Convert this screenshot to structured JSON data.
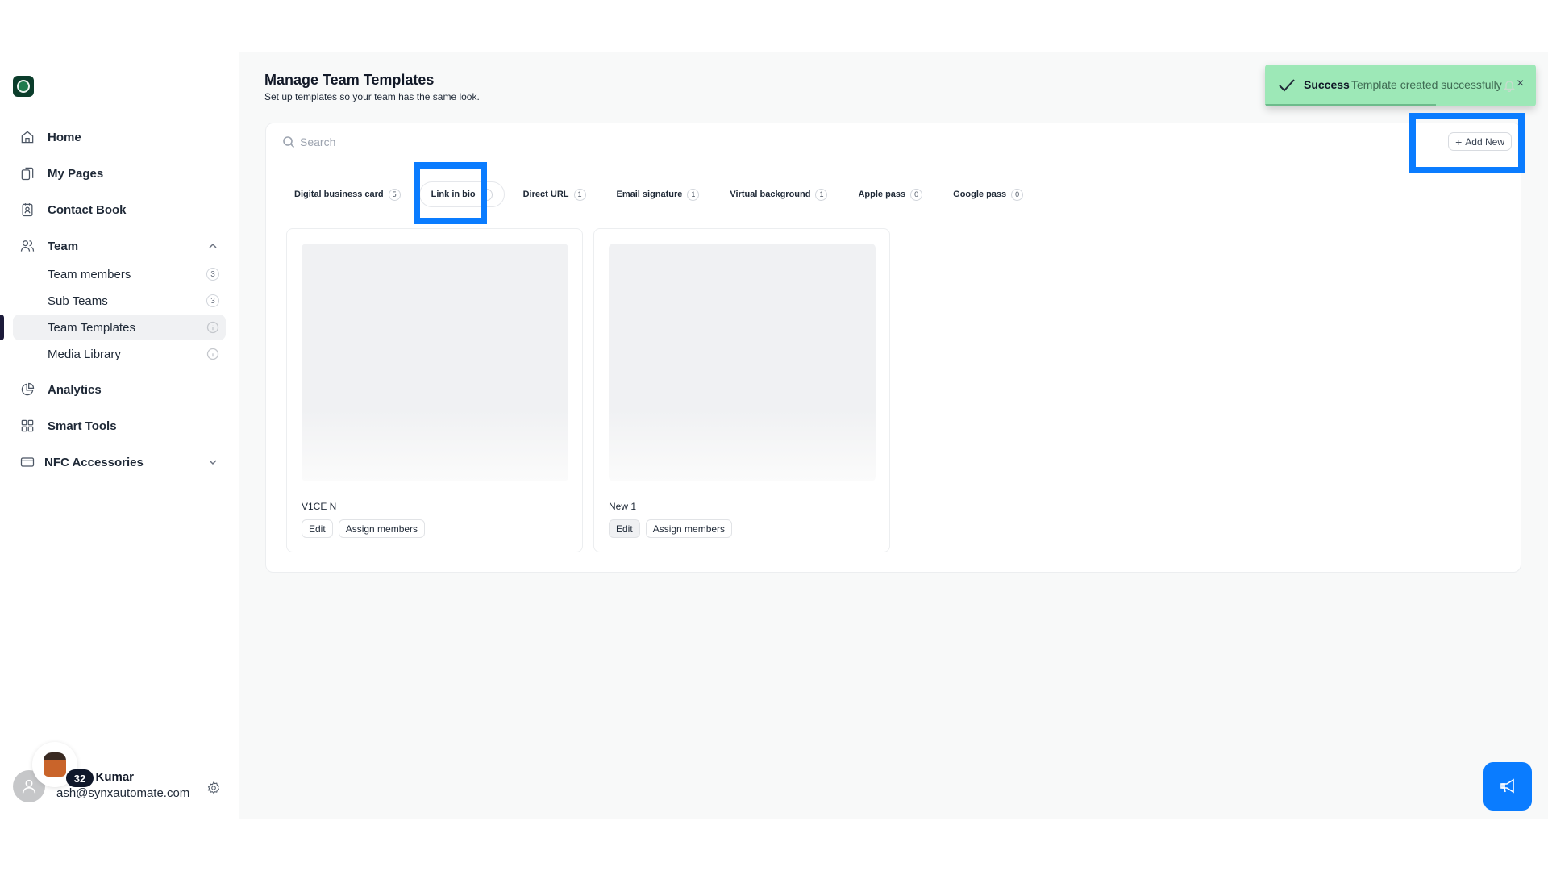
{
  "sidebar": {
    "nav": [
      {
        "label": "Home",
        "icon": "home-icon"
      },
      {
        "label": "My Pages",
        "icon": "pages-icon"
      },
      {
        "label": "Contact Book",
        "icon": "contact-book-icon"
      },
      {
        "label": "Team",
        "icon": "team-icon",
        "expanded": true
      },
      {
        "label": "Analytics",
        "icon": "analytics-icon"
      },
      {
        "label": "Smart Tools",
        "icon": "grid-icon"
      },
      {
        "label": "NFC Accessories",
        "icon": "card-icon",
        "expanded": false
      }
    ],
    "team_sub": [
      {
        "label": "Team members",
        "count": "3"
      },
      {
        "label": "Sub Teams",
        "count": "3"
      },
      {
        "label": "Team Templates",
        "active": true
      },
      {
        "label": "Media Library"
      }
    ],
    "user": {
      "badge": "32",
      "name": "y Kumar",
      "email": "ash@synxautomate.com"
    }
  },
  "main": {
    "title": "Manage Team Templates",
    "subtitle": "Set up templates so your team has the same look.",
    "search": {
      "placeholder": "Search",
      "value": ""
    },
    "add_new_label": "Add New",
    "tabs": [
      {
        "label": "Digital business card",
        "count": "5"
      },
      {
        "label": "Link in bio",
        "count": "",
        "active": true
      },
      {
        "label": "Direct URL",
        "count": "1"
      },
      {
        "label": "Email signature",
        "count": "1"
      },
      {
        "label": "Virtual background",
        "count": "1"
      },
      {
        "label": "Apple pass",
        "count": "0"
      },
      {
        "label": "Google pass",
        "count": "0"
      }
    ],
    "templates": [
      {
        "name": "V1CE N",
        "edit_label": "Edit",
        "assign_label": "Assign members"
      },
      {
        "name": "New 1",
        "edit_label": "Edit",
        "assign_label": "Assign members"
      }
    ]
  },
  "toast": {
    "title": "Success",
    "message": "Template created successfully",
    "close": "×",
    "progress": 0.63
  },
  "colors": {
    "accent": "#0a7cff",
    "toast_bg": "#9de8b7",
    "active_nav_bg": "#f0f1f3",
    "brand_logo": "#0b3d2b"
  }
}
